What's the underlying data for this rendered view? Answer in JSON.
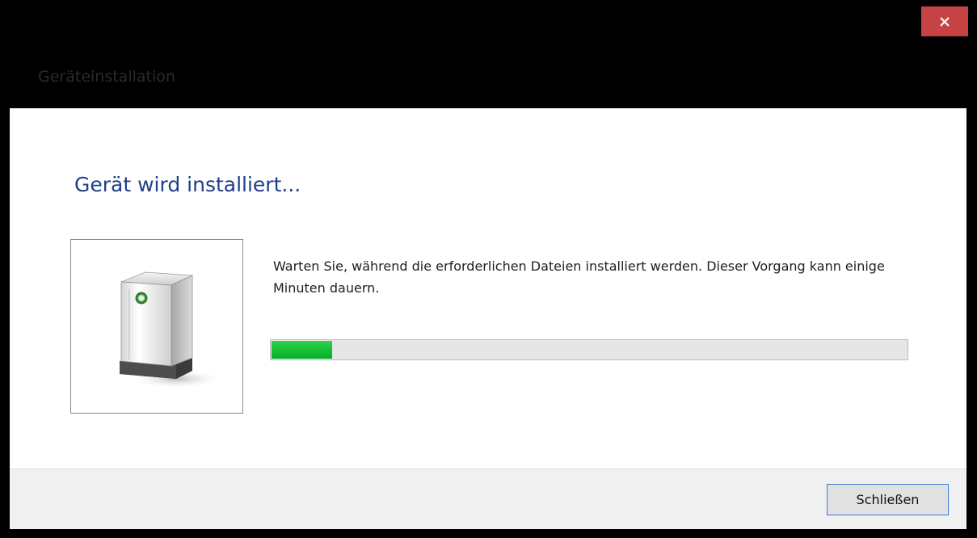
{
  "window": {
    "title": "Geräteinstallation"
  },
  "main": {
    "heading": "Gerät wird installiert...",
    "message": "Warten Sie, während die erforderlichen Dateien installiert werden. Dieser Vorgang kann einige Minuten dauern.",
    "progress_fraction": 0.095,
    "device_icon": "device-icon"
  },
  "footer": {
    "close_button_label": "Schließen"
  },
  "colors": {
    "title_bar": "#000000",
    "close_button": "#c74343",
    "heading": "#1f3f8a",
    "progress_fill": "#06b025",
    "progress_track": "#e6e6e6",
    "footer": "#f0f0f0",
    "button_focus_border": "#3c7fd4"
  }
}
